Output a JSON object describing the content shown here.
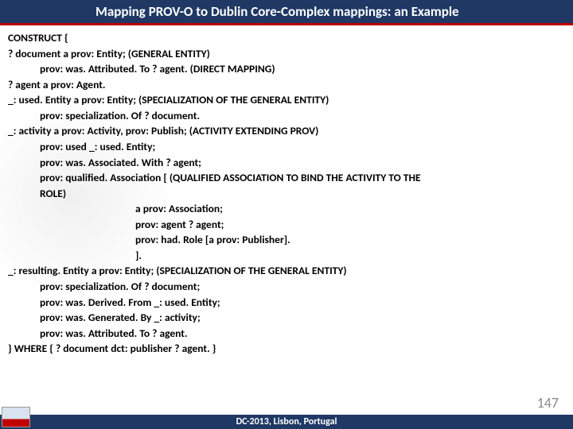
{
  "title": "Mapping PROV-O to Dublin Core-Complex mappings: an Example",
  "lines": [
    {
      "cls": "l0",
      "text": "CONSTRUCT {"
    },
    {
      "cls": "l0",
      "text": " ? document a prov: Entity;    (GENERAL ENTITY)"
    },
    {
      "cls": "l1",
      "text": "prov: was. Attributed. To ? agent.  (DIRECT MAPPING)"
    },
    {
      "cls": "l0",
      "text": "? agent a prov: Agent."
    },
    {
      "cls": "l0",
      "text": "_: used. Entity a prov: Entity;  (SPECIALIZATION OF THE GENERAL  ENTITY)"
    },
    {
      "cls": "l1",
      "text": "prov: specialization. Of ? document."
    },
    {
      "cls": "l0",
      "text": "_: activity a prov: Activity, prov: Publish; (ACTIVITY EXTENDING PROV)"
    },
    {
      "cls": "l1",
      "text": "prov: used _: used. Entity;"
    },
    {
      "cls": "l1",
      "text": "prov: was. Associated. With ? agent;"
    },
    {
      "cls": "l1",
      "text": "prov: qualified. Association [ (QUALIFIED ASSOCIATION TO BIND THE ACTIVITY TO THE"
    },
    {
      "cls": "l1",
      "text": "ROLE)"
    },
    {
      "cls": "l2",
      "text": "a prov: Association;"
    },
    {
      "cls": "l2",
      "text": "prov: agent ? agent;"
    },
    {
      "cls": "l2",
      "text": "prov: had. Role [a prov: Publisher]."
    },
    {
      "cls": "l2",
      "text": "]."
    },
    {
      "cls": "l0",
      "text": "_: resulting. Entity a prov: Entity; (SPECIALIZATION OF THE GENERAL  ENTITY)"
    },
    {
      "cls": "l1",
      "text": "prov: specialization. Of ? document;"
    },
    {
      "cls": "l1",
      "text": "prov: was. Derived. From _: used. Entity;"
    },
    {
      "cls": "l1",
      "text": "prov: was. Generated. By _: activity;"
    },
    {
      "cls": "l1",
      "text": "prov: was. Attributed. To ? agent."
    },
    {
      "cls": "l0",
      "text": "} WHERE { ? document dct: publisher ? agent. }"
    }
  ],
  "footer": "DC-2013, Lisbon, Portugal",
  "page_number": "147"
}
